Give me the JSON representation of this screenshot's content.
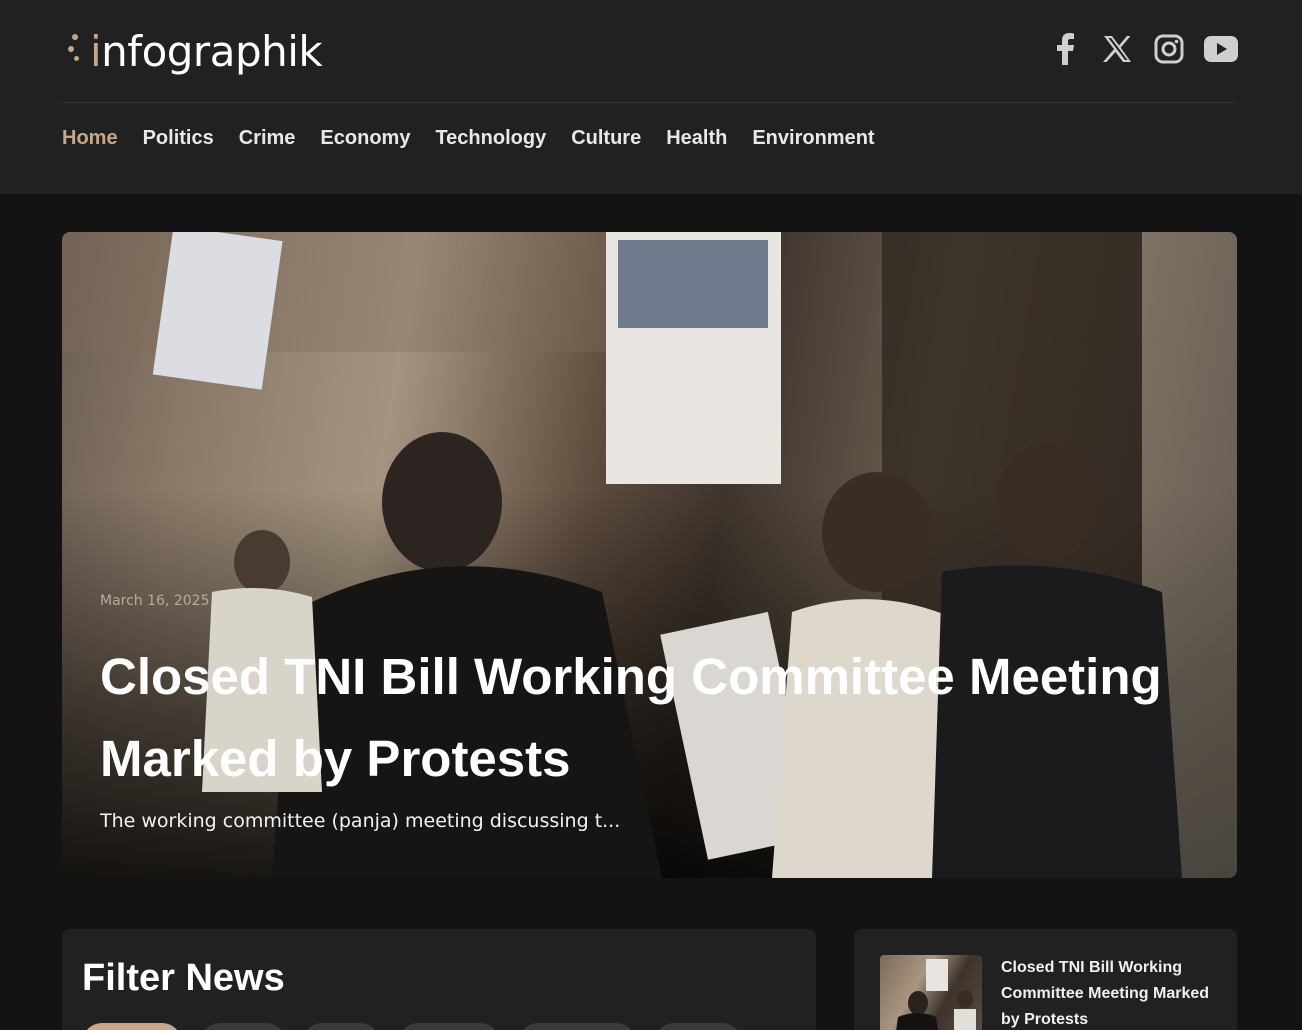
{
  "brand": {
    "logo_first": "i",
    "logo_rest": "nfographik"
  },
  "social": [
    {
      "icon": "facebook-icon"
    },
    {
      "icon": "x-icon"
    },
    {
      "icon": "instagram-icon"
    },
    {
      "icon": "youtube-icon"
    }
  ],
  "nav": {
    "items": [
      "Home",
      "Politics",
      "Crime",
      "Economy",
      "Technology",
      "Culture",
      "Health",
      "Environment"
    ],
    "active": "Home"
  },
  "hero": {
    "date": "March 16, 2025",
    "title": "Closed TNI Bill Working Committee Meeting Marked by Protests",
    "excerpt": "The working committee (panja) meeting discussing t..."
  },
  "filter": {
    "heading": "Filter News"
  },
  "sidebar": {
    "latest_title": "Closed TNI Bill Working Committee Meeting Marked by Protests"
  },
  "colors": {
    "accent": "#c7a68a",
    "header_bg": "#212121",
    "page_bg": "#131313"
  }
}
